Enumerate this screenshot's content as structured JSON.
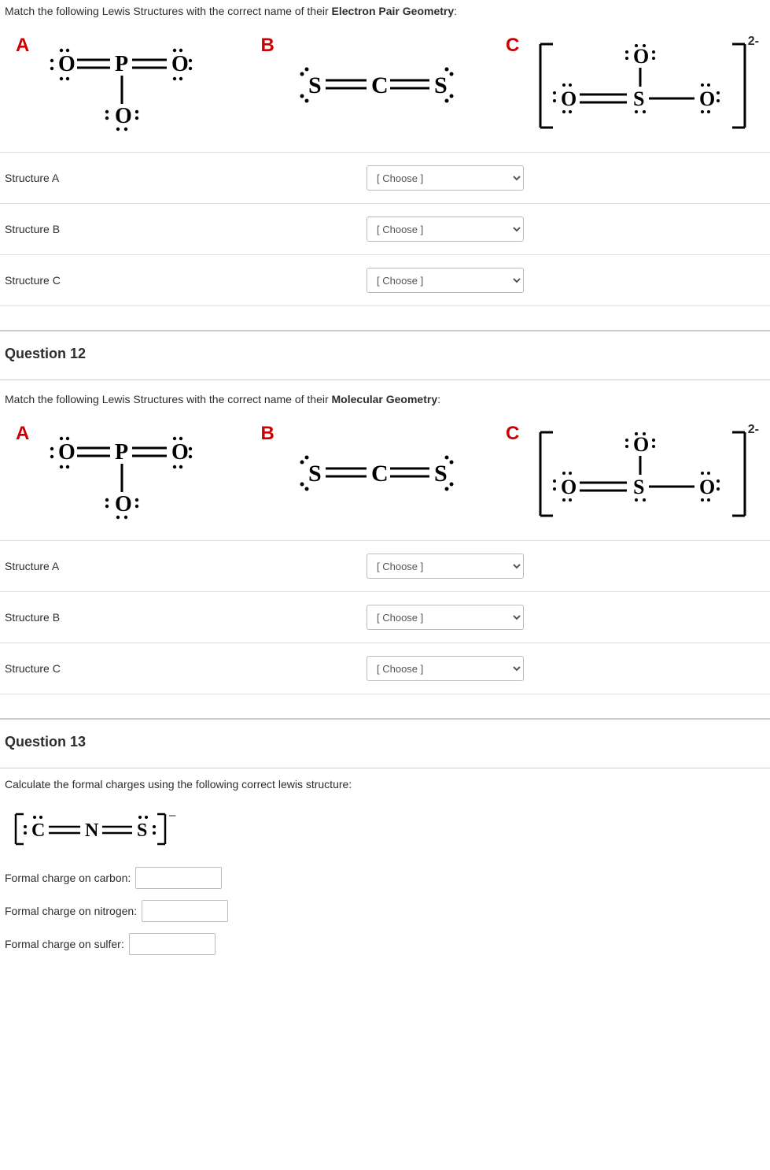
{
  "q11": {
    "prompt_prefix": "Match the following Lewis Structures with the correct name of their ",
    "prompt_bold": "Electron Pair Geometry",
    "prompt_suffix": ":",
    "labels": {
      "a": "A",
      "b": "B",
      "c": "C"
    },
    "charge_c": "2-",
    "rows": [
      {
        "label": "Structure A",
        "placeholder": "[ Choose ]"
      },
      {
        "label": "Structure B",
        "placeholder": "[ Choose ]"
      },
      {
        "label": "Structure C",
        "placeholder": "[ Choose ]"
      }
    ]
  },
  "q12": {
    "header": "Question 12",
    "prompt_prefix": "Match the following Lewis Structures with the correct name of their ",
    "prompt_bold": "Molecular Geometry",
    "prompt_suffix": ":",
    "labels": {
      "a": "A",
      "b": "B",
      "c": "C"
    },
    "charge_c": "2-",
    "rows": [
      {
        "label": "Structure A",
        "placeholder": "[ Choose ]"
      },
      {
        "label": "Structure B",
        "placeholder": "[ Choose ]"
      },
      {
        "label": "Structure C",
        "placeholder": "[ Choose ]"
      }
    ]
  },
  "q13": {
    "header": "Question 13",
    "prompt": "Calculate the formal charges using the following correct lewis structure:",
    "charge": "−",
    "fc": [
      "Formal charge on carbon:",
      "Formal charge on nitrogen:",
      "Formal charge on sulfer:"
    ]
  },
  "lewis": {
    "A": {
      "atoms": [
        "O",
        "P",
        "O",
        "O"
      ],
      "desc": "O=P=O with O below P, lone pairs on O"
    },
    "B": {
      "atoms": [
        "S",
        "C",
        "S"
      ],
      "desc": "S=C=S linear with lone pairs on S"
    },
    "C": {
      "atoms": [
        "O",
        "S",
        "O",
        "O"
      ],
      "desc": "[O=S-O with O above S]2- bracketed ion"
    },
    "NCS": {
      "atoms": [
        "C",
        "N",
        "S"
      ],
      "desc": "[C=N=S]- bracketed"
    }
  }
}
